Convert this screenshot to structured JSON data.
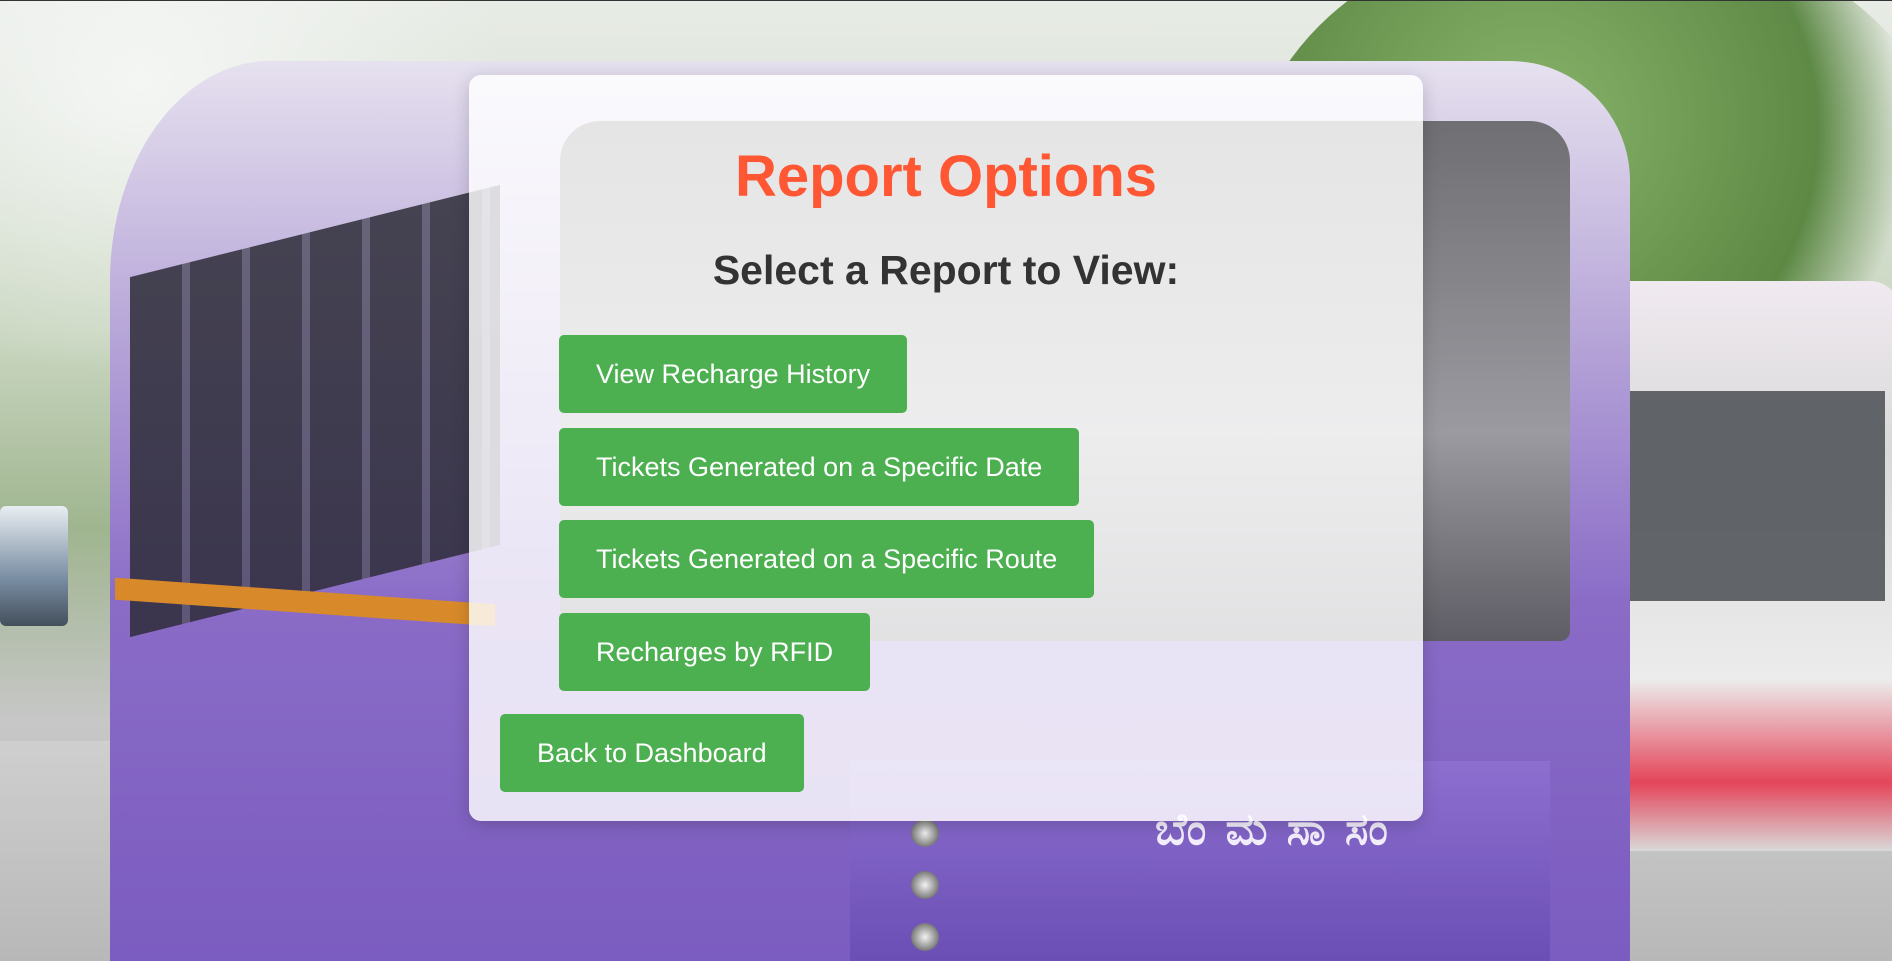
{
  "page": {
    "title": "Report Options",
    "subtitle": "Select a Report to View:"
  },
  "reports": [
    {
      "label": "View Recharge History"
    },
    {
      "label": "Tickets Generated on a Specific Date"
    },
    {
      "label": "Tickets Generated on a Specific Route"
    },
    {
      "label": "Recharges by RFID"
    }
  ],
  "navigation": {
    "back_label": "Back to Dashboard"
  },
  "background": {
    "bus_text": "ಬೆಂ ಮ ಸಾ ಸಂ"
  },
  "colors": {
    "title": "#ff5733",
    "button": "#4caf50",
    "subtitle": "#333333"
  }
}
